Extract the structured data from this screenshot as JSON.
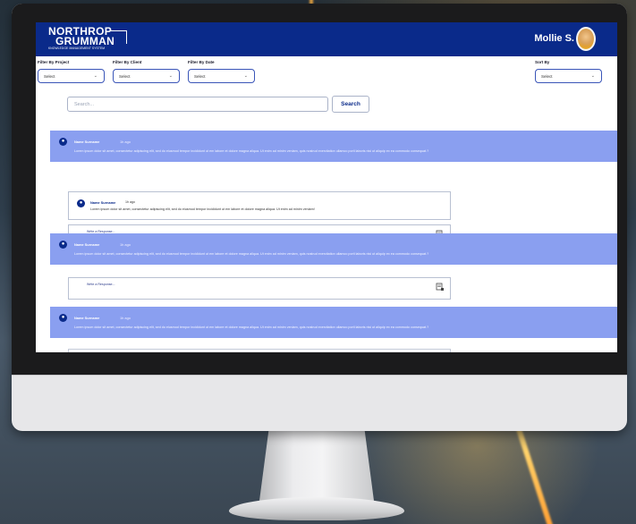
{
  "header": {
    "logo_line1": "NORTHROP",
    "logo_line2": "GRUMMAN",
    "logo_sub": "KNOWLEDGE MANAGEMENT SYSTEM",
    "user_name": "Mollie S."
  },
  "filters": {
    "project_label": "Filter By Project",
    "client_label": "Filter By Client",
    "date_label": "Filter By Date",
    "sort_label": "Sort By",
    "project_value": "Select",
    "client_value": "Select",
    "date_value": "Select",
    "sort_value": "Select"
  },
  "search": {
    "placeholder": "Search...",
    "button_label": "Search"
  },
  "posts": [
    {
      "name": "Name Surname",
      "time": "1h ago",
      "text": "Lorem ipsum dolor sit amet, consectetur adipiscing elit, sed do eiusmod tempor incididunt ut em labore et dolore magna aliqua. Ut enim ad minim veniam, quis nostrud exercitation ullamco porti laboris nisi ut aliquip ex ea commodo consequat.?"
    },
    {
      "name": "Name Surname",
      "time": "1h ago",
      "text": "Lorem ipsum dolor sit amet, consectetur adipiscing elit, sed do eiusmod tempor incididunt ut em labore et dolore magna aliqua. Ut enim ad minim veniam, quis nostrud exercitation ullamco porti laboris nisi ut aliquip ex ea commodo consequat.?"
    },
    {
      "name": "Name Surname",
      "time": "1h ago",
      "text": "Lorem ipsum dolor sit amet, consectetur adipiscing elit, sed do eiusmod tempor incididunt ut em labore et dolore magna aliqua. Ut enim ad minim veniam, quis nostrud exercitation ullamco porti laboris nisi ut aliquip ex ea commodo consequat.?"
    }
  ],
  "reply": {
    "name": "Name Surname",
    "time": "1h ago",
    "text": "Lorem ipsum dolor sit amet, consectetur adipiscing elit, sed do eiusmod tempor incididunt ut em labore et dolore magna aliqua. Ut enim ad minim veniam!"
  },
  "response": {
    "placeholder": "Write a Response..."
  },
  "icons": {
    "user": "user-icon",
    "chevron": "chevron-down-icon",
    "attach": "document-attach-icon"
  },
  "colors": {
    "topbar": "#0a2a8a",
    "post_bg": "#8a9ff0",
    "accent": "#0a2a8a"
  }
}
